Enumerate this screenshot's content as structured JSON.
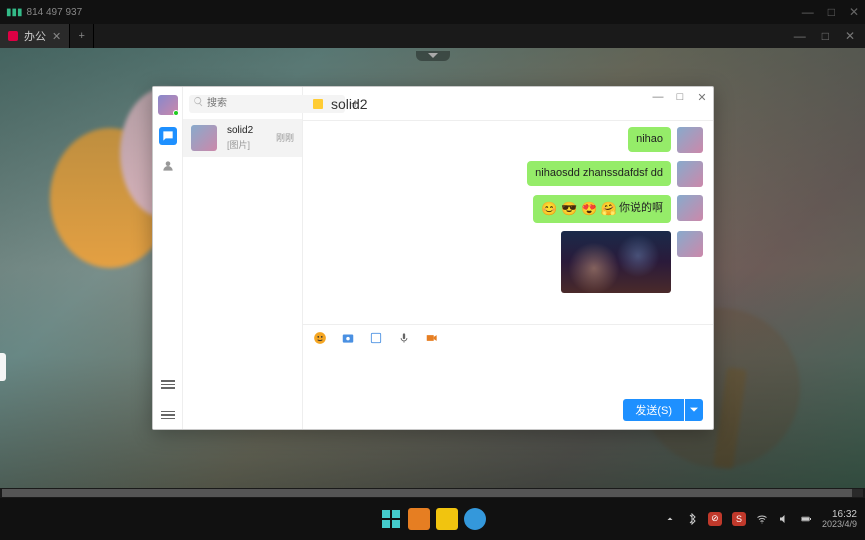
{
  "sysbar": {
    "signal_text": "814 497 937"
  },
  "browser": {
    "tabs": [
      {
        "label": "办公",
        "color": "#d04",
        "active": true
      }
    ],
    "new_tab": "+",
    "minimize": "—",
    "maximize": "□",
    "close": "✕"
  },
  "app": {
    "search_placeholder": "搜索",
    "add": "+",
    "conversations": [
      {
        "name": "solid2",
        "preview": "[图片]",
        "time": "刚刚"
      }
    ],
    "chat": {
      "title": "solid2",
      "winctl": {
        "min": "—",
        "max": "□",
        "close": "✕"
      },
      "messages": [
        {
          "type": "text",
          "text": "nihao"
        },
        {
          "type": "text",
          "text": "nihaosdd zhanssdafdsf dd"
        },
        {
          "type": "emoji",
          "emojis": "😊 😎 😍 🤗",
          "text": "你说的啊"
        },
        {
          "type": "image"
        }
      ],
      "toolbar_icons": [
        "emoji",
        "screenshot",
        "file",
        "voice",
        "video"
      ],
      "send_label": "发送(S)"
    }
  },
  "taskbar": {
    "time": "16:32",
    "date": "2023/4/9"
  }
}
